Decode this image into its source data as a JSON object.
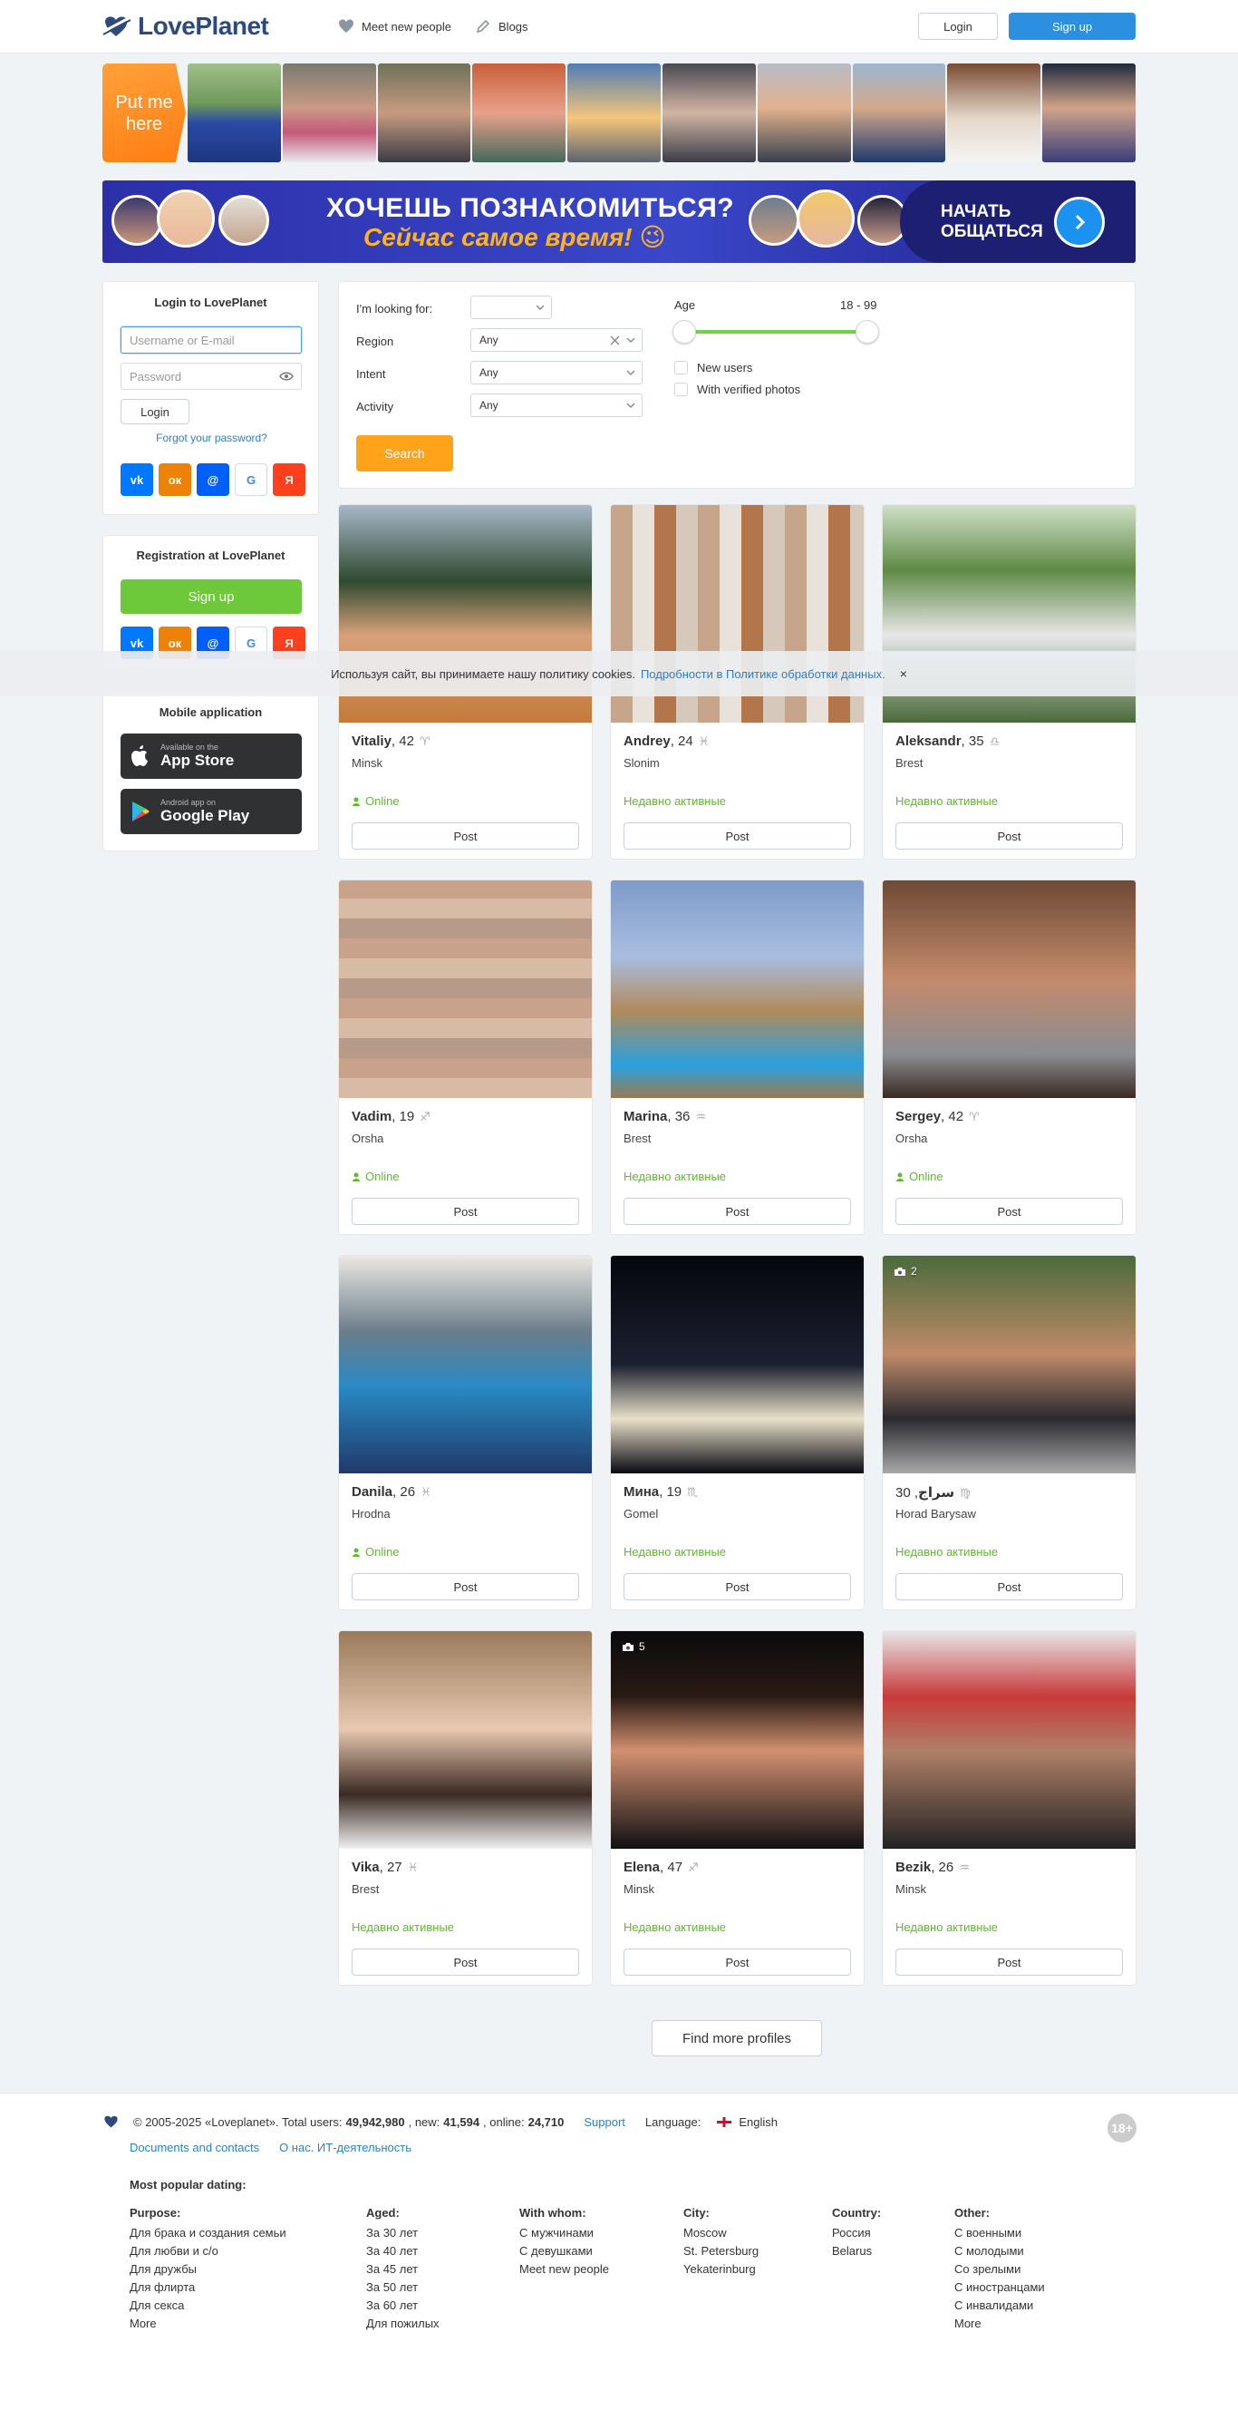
{
  "header": {
    "logo_text": "LovePlanet",
    "nav": [
      {
        "label": "Meet new people",
        "icon": "heart-icon"
      },
      {
        "label": "Blogs",
        "icon": "pencil-icon"
      }
    ],
    "login_label": "Login",
    "signup_label": "Sign up"
  },
  "strip": {
    "put_me_here": "Put me here"
  },
  "banner": {
    "line1": "ХОЧЕШЬ ПОЗНАКОМИТЬСЯ?",
    "line2": "Сейчас самое время! 😉",
    "cta": "НАЧАТЬ ОБЩАТЬСЯ"
  },
  "login_panel": {
    "title": "Login to LovePlanet",
    "username_placeholder": "Username or E-mail",
    "password_placeholder": "Password",
    "login_button": "Login",
    "forgot": "Forgot your password?"
  },
  "registration_panel": {
    "title": "Registration at LovePlanet",
    "signup_button": "Sign up"
  },
  "social": [
    {
      "name": "vk-icon",
      "text": "vk",
      "color": "#0077ff"
    },
    {
      "name": "odnoklassniki-icon",
      "text": "ок",
      "color": "#ee8208"
    },
    {
      "name": "mailru-icon",
      "text": "@",
      "color": "#005ff9"
    },
    {
      "name": "google-icon",
      "text": "G",
      "color": "#ffffff"
    },
    {
      "name": "yandex-icon",
      "text": "Я",
      "color": "#fc3f1d"
    }
  ],
  "mobile_panel": {
    "title": "Mobile application",
    "appstore_small": "Available on the",
    "appstore_big": "App Store",
    "gplay_small": "Android app on",
    "gplay_big": "Google Play"
  },
  "search": {
    "looking_for_label": "I'm looking for:",
    "looking_for_value": "",
    "region_label": "Region",
    "region_value": "Any",
    "intent_label": "Intent",
    "intent_value": "Any",
    "activity_label": "Activity",
    "activity_value": "Any",
    "age_label": "Age",
    "age_value": "18 - 99",
    "age_min": 18,
    "age_max": 99,
    "new_users": "New users",
    "verified": "With verified photos",
    "button": "Search"
  },
  "cookie": {
    "text": "Используя сайт, вы принимаете нашу политику cookies.",
    "link": "Подробности в Политике обработки данных.",
    "close": "×"
  },
  "profiles": [
    {
      "name": "Vitaliy",
      "age": "42",
      "zodiac": "♈",
      "city": "Minsk",
      "status": "Online",
      "post": "Post",
      "photos": ""
    },
    {
      "name": "Andrey",
      "age": "24",
      "zodiac": "♓",
      "city": "Slonim",
      "status": "Недавно активные",
      "post": "Post",
      "photos": ""
    },
    {
      "name": "Aleksandr",
      "age": "35",
      "zodiac": "♎",
      "city": "Brest",
      "status": "Недавно активные",
      "post": "Post",
      "photos": ""
    },
    {
      "name": "Vadim",
      "age": "19",
      "zodiac": "♐",
      "city": "Orsha",
      "status": "Online",
      "post": "Post",
      "photos": ""
    },
    {
      "name": "Marina",
      "age": "36",
      "zodiac": "♒",
      "city": "Brest",
      "status": "Недавно активные",
      "post": "Post",
      "photos": ""
    },
    {
      "name": "Sergey",
      "age": "42",
      "zodiac": "♈",
      "city": "Orsha",
      "status": "Online",
      "post": "Post",
      "photos": ""
    },
    {
      "name": "Danila",
      "age": "26",
      "zodiac": "♓",
      "city": "Hrodna",
      "status": "Online",
      "post": "Post",
      "photos": ""
    },
    {
      "name": "Мина",
      "age": "19",
      "zodiac": "♏",
      "city": "Gomel",
      "status": "Недавно активные",
      "post": "Post",
      "photos": ""
    },
    {
      "name": "سراج",
      "age": "30",
      "zodiac": "♍",
      "city": "Horad Barysaw",
      "status": "Недавно активные",
      "post": "Post",
      "photos": "2"
    },
    {
      "name": "Vika",
      "age": "27",
      "zodiac": "♓",
      "city": "Brest",
      "status": "Недавно активные",
      "post": "Post",
      "photos": ""
    },
    {
      "name": "Elena",
      "age": "47",
      "zodiac": "♐",
      "city": "Minsk",
      "status": "Недавно активные",
      "post": "Post",
      "photos": "5"
    },
    {
      "name": "Bezik",
      "age": "26",
      "zodiac": "♒",
      "city": "Minsk",
      "status": "Недавно активные",
      "post": "Post",
      "photos": ""
    }
  ],
  "find_more": "Find more profiles",
  "footer": {
    "copyright": "© 2005-2025 «Loveplanet». Total users:",
    "total": "49,942,980",
    "new_label": ", new:",
    "new": "41,594",
    "online_label": ", online:",
    "online": "24,710",
    "support": "Support",
    "language_label": "Language:",
    "language": "English",
    "docs": "Documents and contacts",
    "about": "О нас. ИТ-деятельность",
    "popular": "Most popular dating:",
    "badge": "18+",
    "columns": [
      {
        "title": "Purpose:",
        "items": [
          "Для брака и создания семьи",
          "Для любви и с/о",
          "Для дружбы",
          "Для флирта",
          "Для секса",
          "More"
        ]
      },
      {
        "title": "Aged:",
        "items": [
          "За 30 лет",
          "За 40 лет",
          "За 45 лет",
          "За 50 лет",
          "За 60 лет",
          "Для пожилых"
        ]
      },
      {
        "title": "With whom:",
        "items": [
          "С мужчинами",
          "С девушками",
          "Meet new people"
        ]
      },
      {
        "title": "City:",
        "items": [
          "Moscow",
          "St. Petersburg",
          "Yekaterinburg"
        ]
      },
      {
        "title": "Country:",
        "items": [
          "Россия",
          "Belarus"
        ]
      },
      {
        "title": "Other:",
        "items": [
          "С военными",
          "С молодыми",
          "Со зрелыми",
          "С иностранцами",
          "С инвалидами",
          "More"
        ]
      }
    ]
  }
}
